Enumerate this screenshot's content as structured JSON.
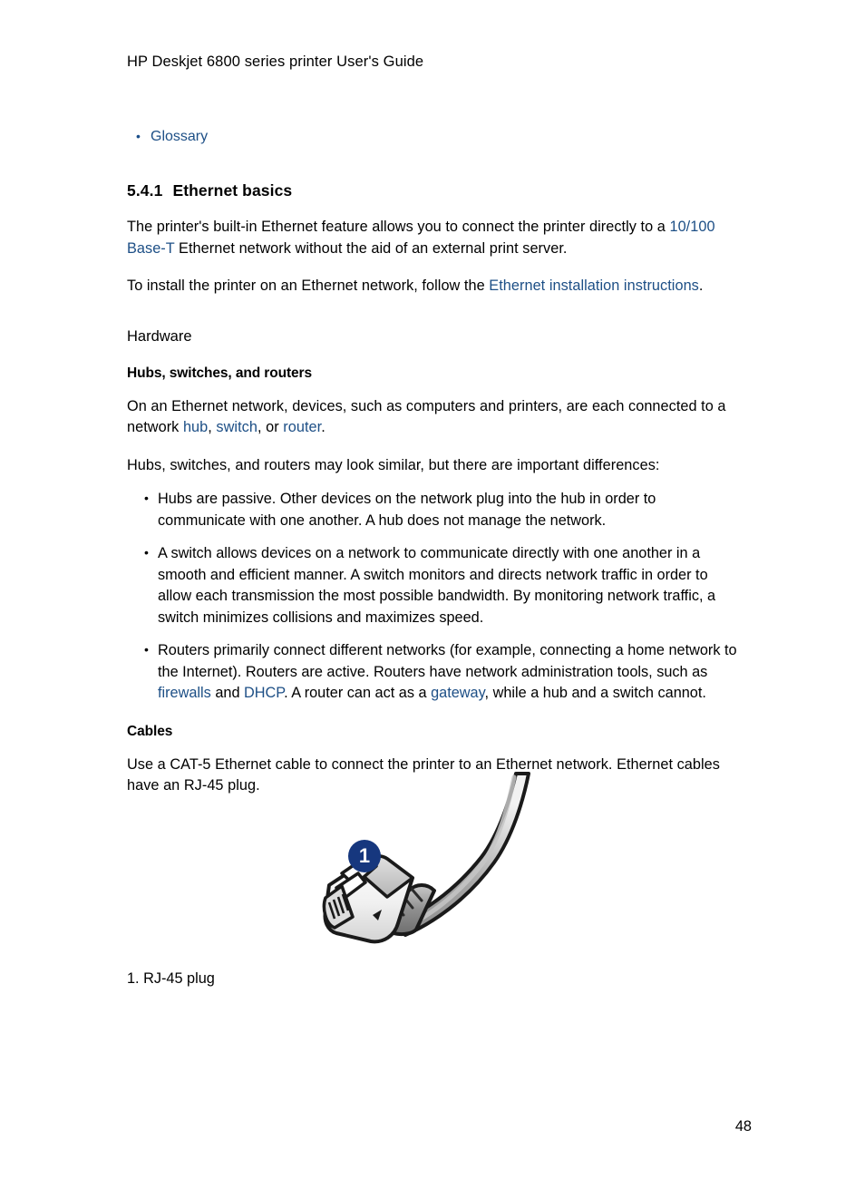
{
  "document": {
    "header": "HP Deskjet 6800 series printer User's Guide",
    "page_number": "48",
    "link_color": "#1d4f86"
  },
  "top_links": [
    {
      "label": "Glossary"
    }
  ],
  "section": {
    "number": "5.4.1",
    "title": "Ethernet basics",
    "intro_paragraph": {
      "part1": "The printer's built-in Ethernet feature allows you to connect the printer directly to a ",
      "link1": "10/100 Base-T",
      "part2": " Ethernet network without the aid of an external print server."
    },
    "install_paragraph": {
      "part1": "To install the printer on an Ethernet network, follow the ",
      "link1": "Ethernet installation instructions",
      "part2": "."
    }
  },
  "hardware": {
    "heading": "Hardware",
    "subheading": "Hubs, switches, and routers",
    "paragraph1": {
      "part1": "On an Ethernet network, devices, such as computers and printers, are each connected to a network ",
      "link1": "hub",
      "part2": ", ",
      "link2": "switch",
      "part3": ", or ",
      "link3": "router",
      "part4": "."
    },
    "paragraph2": "Hubs, switches, and routers may look similar, but there are important differences:",
    "bullets": [
      {
        "text": "Hubs are passive. Other devices on the network plug into the hub in order to communicate with one another. A hub does not manage the network."
      },
      {
        "text": "A switch allows devices on a network to communicate directly with one another in a smooth and efficient manner. A switch monitors and directs network traffic in order to allow each transmission the most possible bandwidth. By monitoring network traffic, a switch minimizes collisions and maximizes speed."
      },
      {
        "part1": "Routers primarily connect different networks (for example, connecting a home network to the Internet). Routers are active. Routers have network administration tools, such as ",
        "link1": "firewalls",
        "part2": " and ",
        "link2": "DHCP",
        "part3": ". A router can act as a ",
        "link3": "gateway",
        "part4": ", while a hub and a switch cannot."
      }
    ]
  },
  "cables": {
    "heading": "Cables",
    "paragraph": "Use a CAT-5 Ethernet cable to connect the printer to an Ethernet network. Ethernet cables have an RJ-45 plug.",
    "figure": {
      "callout_number": "1",
      "callout_color": "#16377e",
      "caption": "1. RJ-45 plug",
      "alt": "ethernet-cable-rj45-plug-illustration"
    }
  }
}
